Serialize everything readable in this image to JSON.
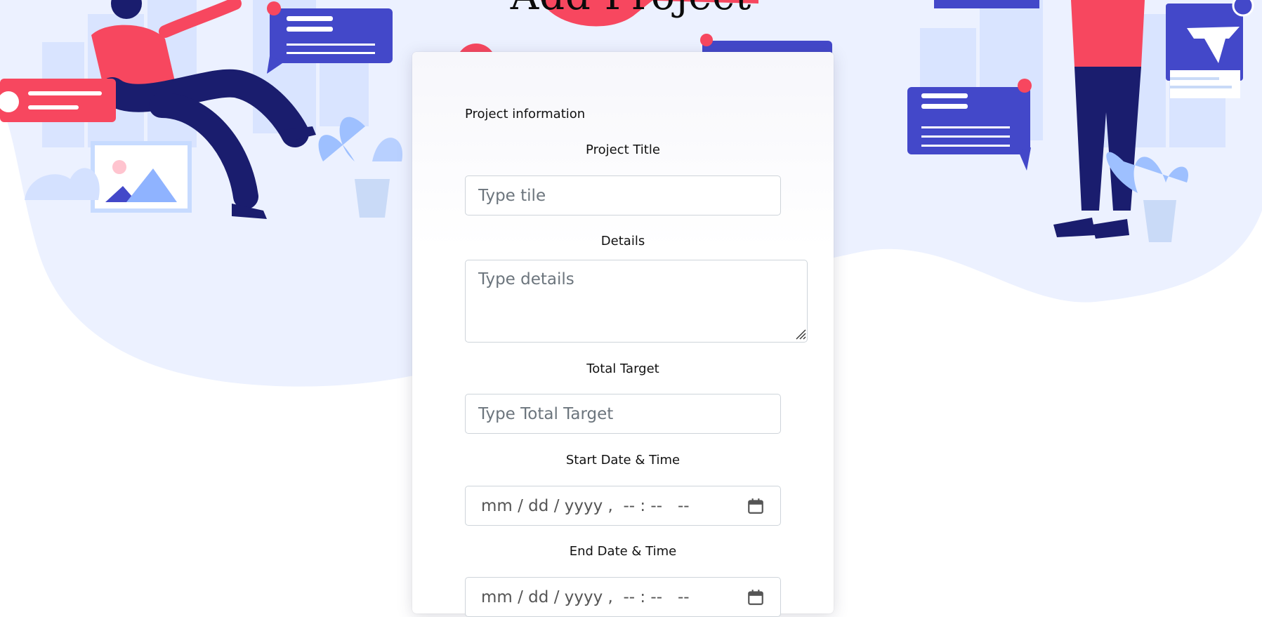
{
  "page": {
    "title": "Add Project"
  },
  "form": {
    "section_heading": "Project information",
    "project_title": {
      "label": "Project Title",
      "placeholder": "Type tile"
    },
    "details": {
      "label": "Details",
      "placeholder": "Type details"
    },
    "total_target": {
      "label": "Total Target",
      "placeholder": "Type Total Target"
    },
    "start_datetime": {
      "label": "Start Date & Time",
      "value": "mm / dd / yyyy ,  -- : --   --"
    },
    "end_datetime": {
      "label": "End Date & Time",
      "value": "mm / dd / yyyy ,  -- : --   --"
    }
  },
  "colors": {
    "accent_pink": "#f7475f",
    "accent_blue": "#4348c9",
    "navy": "#1a1d6e",
    "light_blue": "#e9efff"
  },
  "icons": [
    "calendar-icon",
    "resize-grip-icon"
  ]
}
